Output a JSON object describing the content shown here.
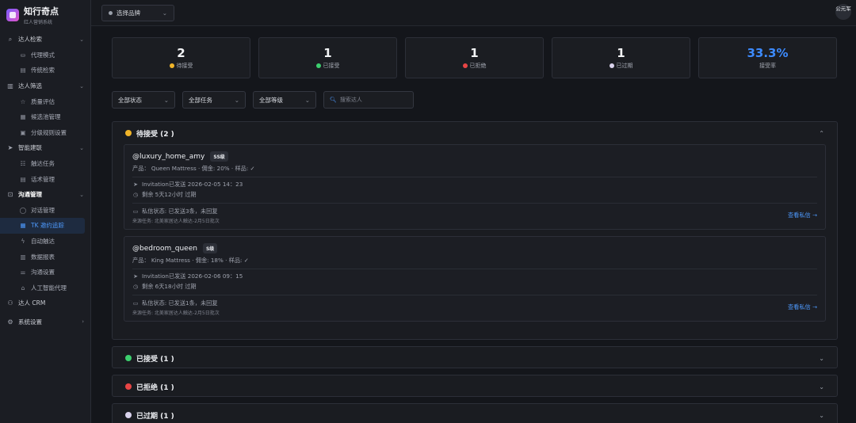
{
  "brand": {
    "title": "知行奇点",
    "subtitle": "红人营销系统"
  },
  "sidebar": {
    "groups": [
      {
        "icon": "search-icon",
        "label": "达人检索",
        "items": [
          {
            "icon": "briefcase-icon",
            "label": "代理模式"
          },
          {
            "icon": "list-icon",
            "label": "传统检索"
          }
        ]
      },
      {
        "icon": "filter-icon",
        "label": "达人筛选",
        "items": [
          {
            "icon": "star-icon",
            "label": "质量评估"
          },
          {
            "icon": "archive-icon",
            "label": "候选池管理"
          },
          {
            "icon": "layers-icon",
            "label": "分级规则设置"
          }
        ]
      },
      {
        "icon": "send-icon",
        "label": "智能建联",
        "items": [
          {
            "icon": "tasks-icon",
            "label": "触达任务"
          },
          {
            "icon": "script-icon",
            "label": "话术管理"
          }
        ]
      },
      {
        "icon": "chat-icon",
        "label": "沟通管理",
        "items": [
          {
            "icon": "message-icon",
            "label": "对话管理"
          },
          {
            "icon": "calendar-icon",
            "label": "TK 邀约追踪"
          },
          {
            "icon": "bolt-icon",
            "label": "自动触达"
          },
          {
            "icon": "report-icon",
            "label": "数据报表"
          },
          {
            "icon": "sliders-icon",
            "label": "沟通设置"
          },
          {
            "icon": "robot-icon",
            "label": "人工智能代理"
          }
        ]
      }
    ],
    "crm": {
      "icon": "users-icon",
      "label": "达人 CRM"
    },
    "settings": {
      "icon": "gear-icon",
      "label": "系统设置"
    }
  },
  "topbar": {
    "brand_select": "选择品牌",
    "avatar": "公元军"
  },
  "stats": [
    {
      "value": "2",
      "label": "待接受",
      "color": "#f0b429"
    },
    {
      "value": "1",
      "label": "已接受",
      "color": "#3ccf6e"
    },
    {
      "value": "1",
      "label": "已拒绝",
      "color": "#e84545"
    },
    {
      "value": "1",
      "label": "已过期",
      "color": "#d9d2ec"
    },
    {
      "value": "33.3%",
      "label": "接受率",
      "color": "#3d8bff"
    }
  ],
  "filters": {
    "status": "全部状态",
    "task": "全部任务",
    "level": "全部等级",
    "search_placeholder": "搜索达人"
  },
  "sections": {
    "pending": {
      "title": "待接受 (2 )",
      "color": "#f0b429"
    },
    "accepted": {
      "title": "已接受 (1 )",
      "color": "#3ccf6e"
    },
    "rejected": {
      "title": "已拒绝 (1 )",
      "color": "#e84545"
    },
    "expired": {
      "title": "已过期 (1 )",
      "color": "#d9d2ec"
    }
  },
  "cards": [
    {
      "handle": "@luxury_home_amy",
      "tier": "SS级",
      "product": "产品： Queen Mattress · 佣金: 20% · 样品: ✓",
      "sent": "Invitation已发送 2026-02-05 14：23",
      "remaining": "剩余 5天12小时 过期",
      "dm_status": "私信状态: 已发送3条，未回复",
      "source": "来源任务: 北美家居达人触达-2月5日批次",
      "view_link": "查看私信 →"
    },
    {
      "handle": "@bedroom_queen",
      "tier": "S级",
      "product": "产品： King Mattress · 佣金: 18% · 样品: ✓",
      "sent": "Invitation已发送 2026-02-06 09：15",
      "remaining": "剩余 6天18小时 过期",
      "dm_status": "私信状态: 已发送1条，未回复",
      "source": "来源任务: 北美家居达人触达-2月5日批次",
      "view_link": "查看私信 →"
    }
  ]
}
